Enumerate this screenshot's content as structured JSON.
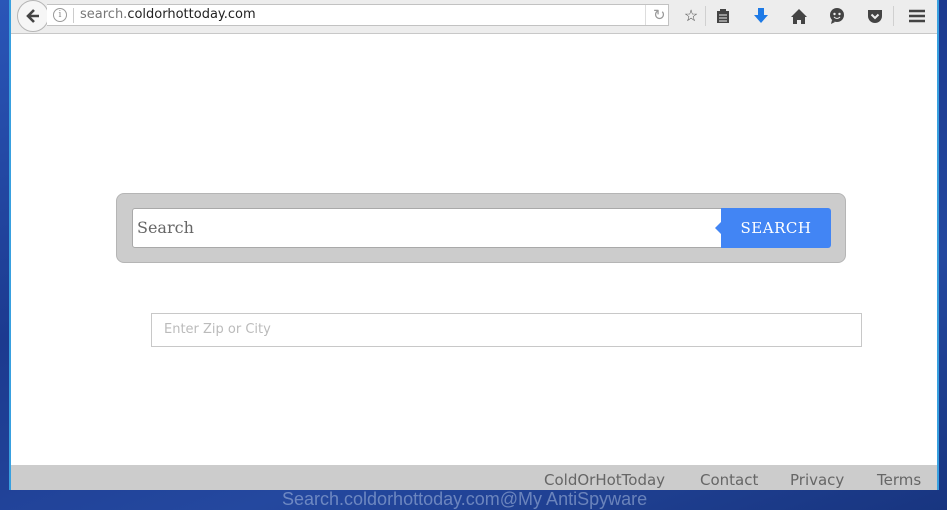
{
  "browser": {
    "url_prefix": "search.",
    "url_domain": "coldorhottoday.com",
    "toolbar_icons": [
      "back-arrow-icon",
      "info-icon",
      "reload-icon",
      "bookmark-star-icon",
      "reading-list-icon",
      "download-icon",
      "home-icon",
      "chat-icon",
      "pocket-icon",
      "menu-icon"
    ]
  },
  "search": {
    "placeholder": "Search",
    "button_label": "SEARCH"
  },
  "weather": {
    "placeholder": "Enter Zip or City"
  },
  "footer": {
    "links": [
      "ColdOrHotToday",
      "Contact",
      "Privacy",
      "Terms"
    ]
  },
  "watermark": "Search.coldorhottoday.com@My AntiSpyware",
  "colors": {
    "accent": "#4285f4",
    "download": "#1e7ae6",
    "footer_bg": "#cccccc"
  }
}
